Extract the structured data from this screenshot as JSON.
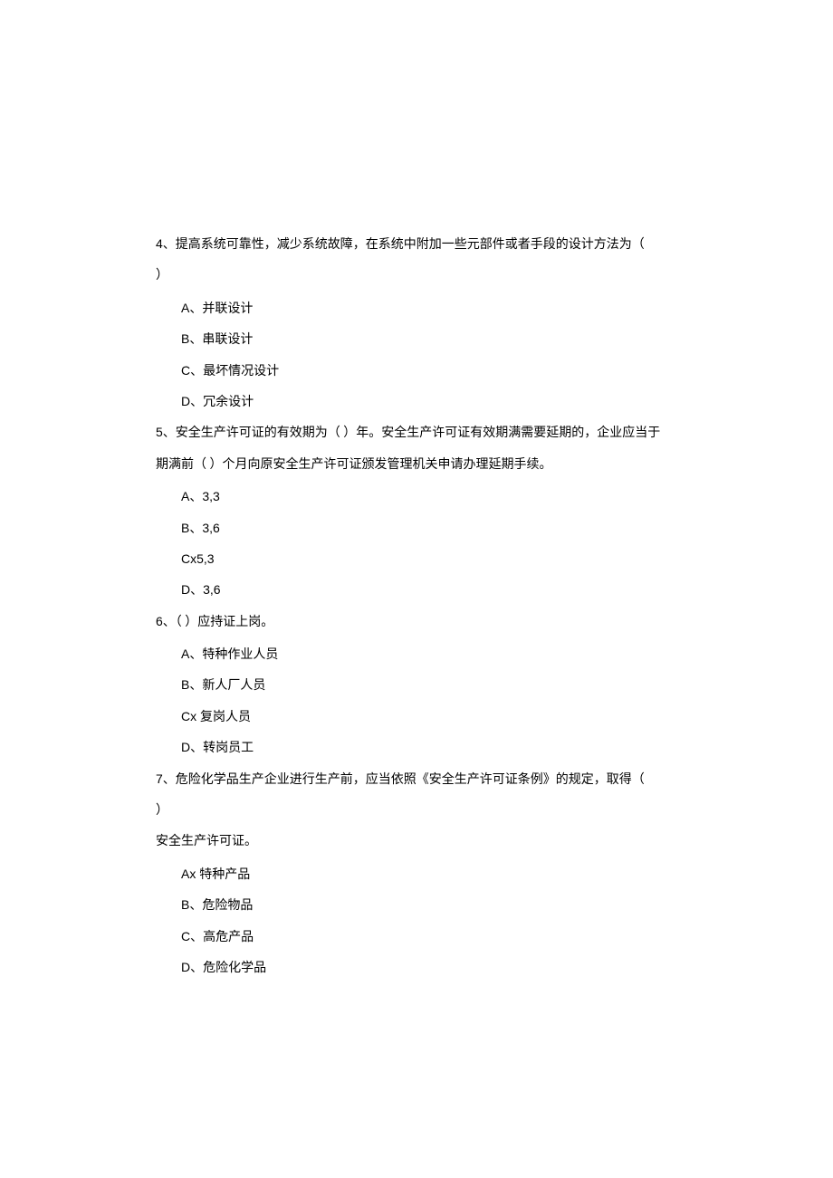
{
  "questions": [
    {
      "number": "4、",
      "stem_line1": "提高系统可靠性，减少系统故障，在系统中附加一些元部件或者手段的设计方法为（",
      "stem_line2": "）",
      "options": [
        {
          "label": "A",
          "sep": "、",
          "text": "并联设计"
        },
        {
          "label": "B",
          "sep": "、",
          "text": "串联设计"
        },
        {
          "label": "C",
          "sep": "、",
          "text": "最坏情况设计"
        },
        {
          "label": "D",
          "sep": "、",
          "text": "冗余设计"
        }
      ]
    },
    {
      "number": "5、",
      "stem_line1": "安全生产许可证的有效期为（      ）年。安全生产许可证有效期满需要延期的，企业应当于",
      "stem_line2": "期满前（      ）个月向原安全生产许可证颁发管理机关申请办理延期手续。",
      "options": [
        {
          "label": "A",
          "sep": "、",
          "text": "3,3"
        },
        {
          "label": "B",
          "sep": "、",
          "text": "3,6"
        },
        {
          "label": "C",
          "sep": "x",
          "text": "5,3"
        },
        {
          "label": "D",
          "sep": "、",
          "text": "3,6"
        }
      ]
    },
    {
      "number": "6、",
      "stem_line1": "（      ）应持证上岗。",
      "options": [
        {
          "label": "A",
          "sep": "、",
          "text": "特种作业人员"
        },
        {
          "label": "B",
          "sep": "、",
          "text": "新人厂人员"
        },
        {
          "label": "C",
          "sep": "x ",
          "text": "复岗人员"
        },
        {
          "label": "D",
          "sep": "、",
          "text": "转岗员工"
        }
      ]
    },
    {
      "number": "7、",
      "stem_line1": "危险化学品生产企业进行生产前，应当依照《安全生产许可证条例》的规定，取得（",
      "stem_line2": "）",
      "stem_line3": "安全生产许可证。",
      "options": [
        {
          "label": "A",
          "sep": "x ",
          "text": "特种产品"
        },
        {
          "label": "B",
          "sep": "、",
          "text": "危险物品"
        },
        {
          "label": "C",
          "sep": "、",
          "text": "高危产品"
        },
        {
          "label": "D",
          "sep": "、",
          "text": "危险化学品"
        }
      ]
    }
  ]
}
